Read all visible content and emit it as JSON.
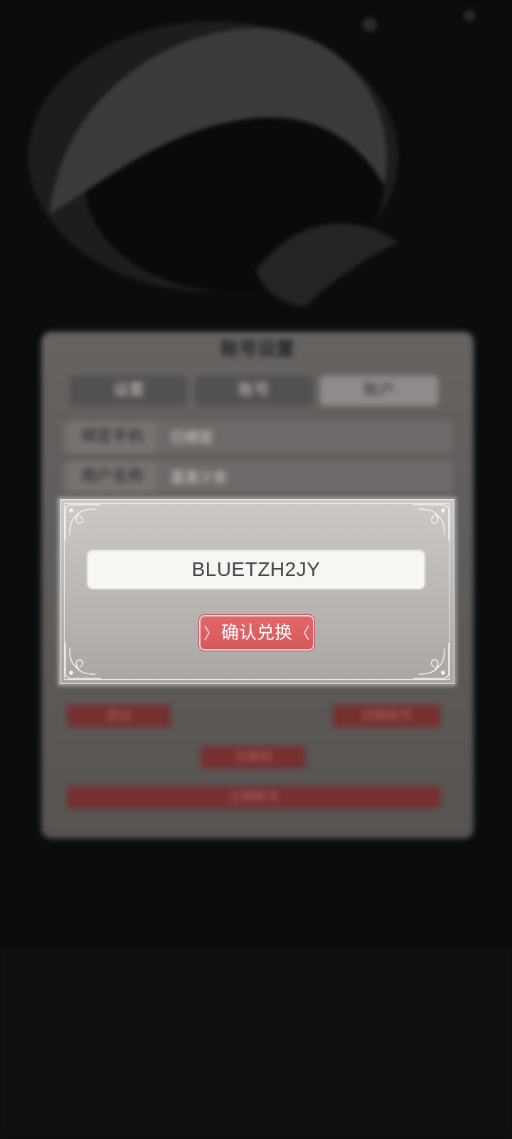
{
  "under_panel": {
    "title": "账号设置",
    "tabs": [
      "设置",
      "账号",
      "账户"
    ],
    "active_tab_index": 2,
    "rows": [
      {
        "label": "绑定手机",
        "value": "已绑定"
      },
      {
        "label": "用户名称",
        "value": "蓝发少女"
      }
    ],
    "buttons": [
      "退出",
      "切换账号",
      "兑换码",
      "注销账号"
    ]
  },
  "dialog": {
    "code_value": "BLUETZH2JY",
    "confirm_label": "确认兑换"
  },
  "colors": {
    "accent": "#d95c5f",
    "dialog_bg": "#bdbab8",
    "field_bg": "#f8f6f3"
  },
  "icons": {
    "corner": "ornament-corner-icon",
    "button_deco": "arrow-deco-icon"
  }
}
